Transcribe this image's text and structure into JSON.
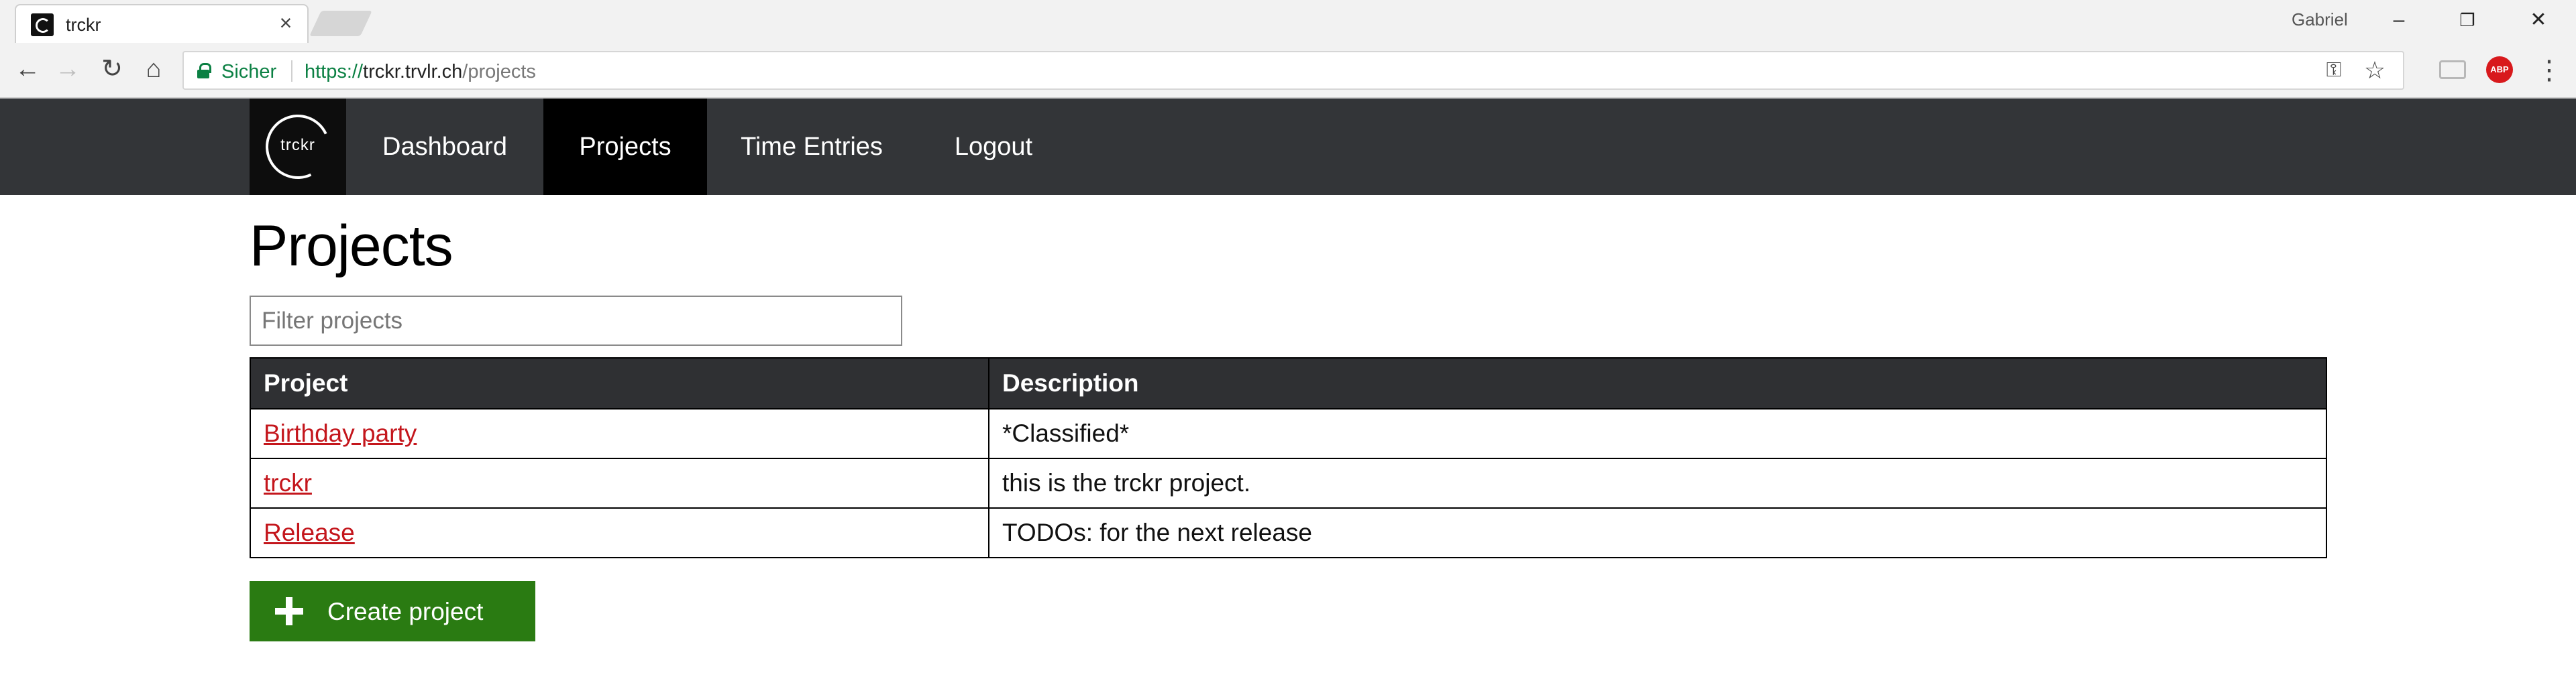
{
  "browser": {
    "tab_title": "trckr",
    "user": "Gabriel",
    "secure_label": "Sicher",
    "url_protocol": "https://",
    "url_host": "trckr.trvlr.ch",
    "url_path": "/projects",
    "extensions": [
      "cast-icon",
      "adblock-plus-icon"
    ],
    "abp_label": "ABP"
  },
  "nav": {
    "brand": "trckr",
    "items": [
      {
        "label": "Dashboard",
        "active": false
      },
      {
        "label": "Projects",
        "active": true
      },
      {
        "label": "Time Entries",
        "active": false
      },
      {
        "label": "Logout",
        "active": false
      }
    ]
  },
  "page": {
    "title": "Projects",
    "filter_placeholder": "Filter projects",
    "filter_value": ""
  },
  "table": {
    "headers": [
      "Project",
      "Description"
    ],
    "rows": [
      {
        "project": "Birthday party",
        "description": "*Classified*"
      },
      {
        "project": "trckr",
        "description": "this is the trckr project."
      },
      {
        "project": "Release",
        "description": "TODOs: for the next release"
      }
    ]
  },
  "actions": {
    "create_label": "Create project"
  },
  "colors": {
    "navbar": "#333538",
    "nav_active": "#000000",
    "link": "#c4161c",
    "create_button": "#2a7b12",
    "table_header": "#2f3033"
  }
}
